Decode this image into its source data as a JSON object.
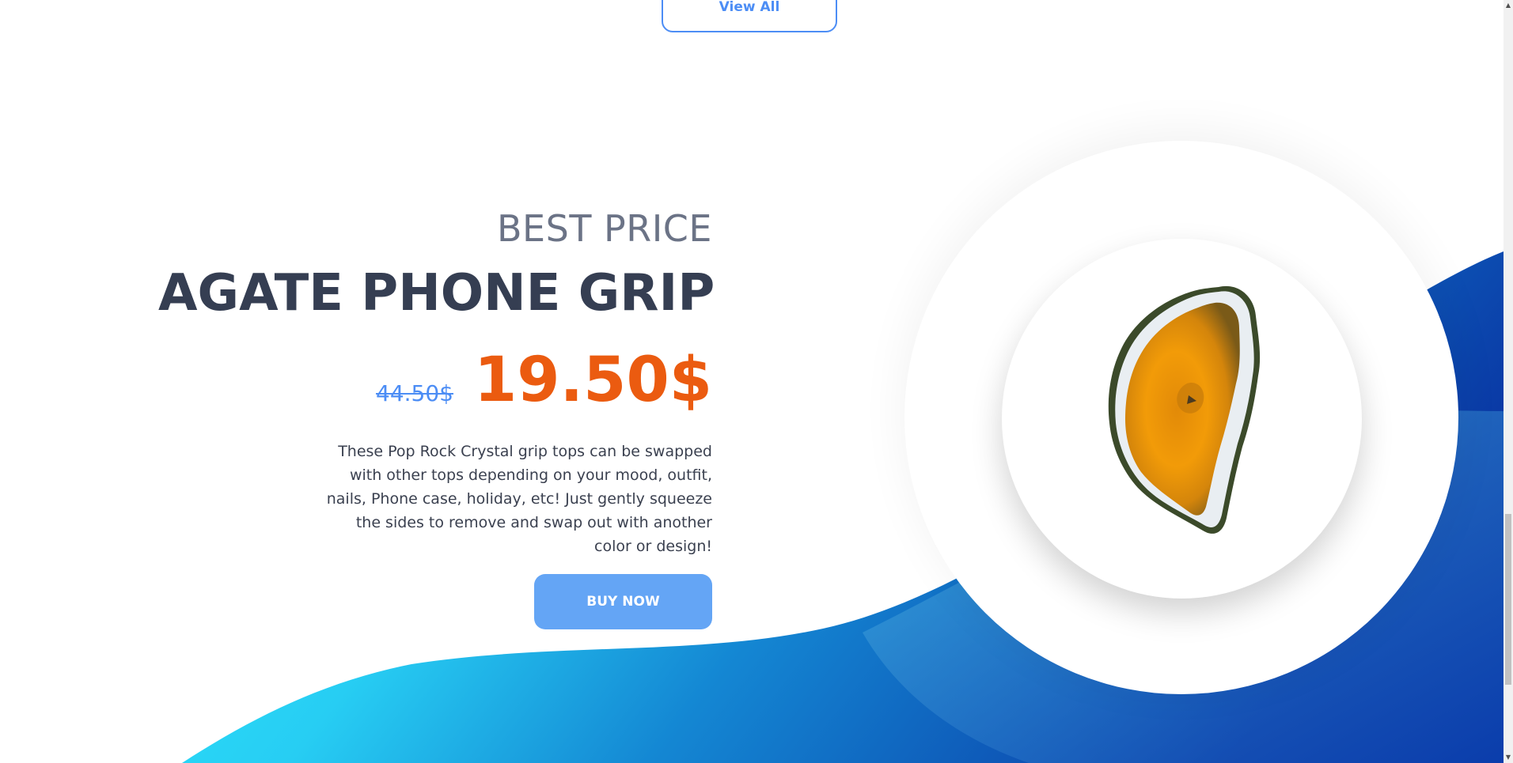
{
  "nav": {
    "view_all_label": "View All"
  },
  "promo": {
    "eyebrow": "BEST PRICE",
    "title": "AGATE PHONE GRIP",
    "old_price": "44.50$",
    "new_price": "19.50$",
    "description": "These Pop Rock Crystal grip tops can be swapped with other tops depending on your mood, outfit, nails, Phone case, holiday, etc! Just gently squeeze the sides to remove and swap out with another color or design!",
    "buy_label": "BUY NOW"
  },
  "product_image": {
    "icon": "agate-stone-image"
  },
  "colors": {
    "accent_blue": "#4c8df5",
    "button_blue": "#64a5f5",
    "price_orange": "#eb5b10",
    "title_dark": "#353e52",
    "eyebrow_gray": "#6b7386",
    "wave_cyan": "#2ef0ff",
    "wave_blue": "#0a3aa6"
  },
  "scrollbar": {
    "up_arrow": "▲",
    "down_arrow": "▼"
  }
}
